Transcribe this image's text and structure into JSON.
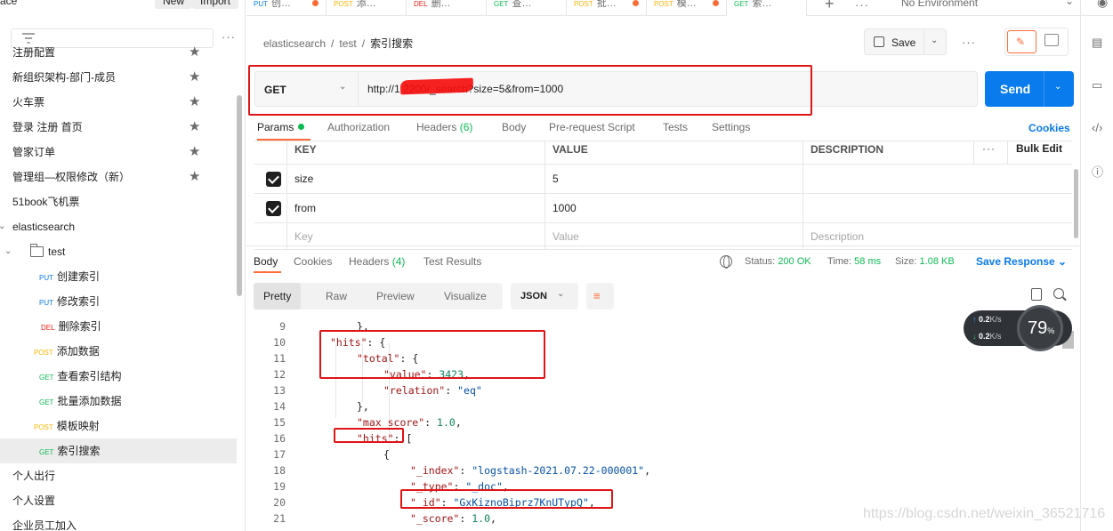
{
  "sidebar": {
    "workspace_title": "ace",
    "new_label": "New",
    "import_label": "Import",
    "more": "···",
    "items": [
      {
        "label": "注册配置",
        "indent": 14,
        "star": true
      },
      {
        "label": "新组织架构-部门-成员",
        "indent": 14,
        "star": true
      },
      {
        "label": "火车票",
        "indent": 14,
        "star": true
      },
      {
        "label": "登录 注册 首页",
        "indent": 14,
        "star": true
      },
      {
        "label": "管家订单",
        "indent": 14,
        "star": true
      },
      {
        "label": "管理组—权限修改（新）",
        "indent": 14,
        "star": true
      },
      {
        "label": "51book飞机票",
        "indent": 14,
        "star": false
      },
      {
        "label": "elasticsearch",
        "indent": 14,
        "star": false
      },
      {
        "label": "test",
        "indent": 54,
        "star": false,
        "folder": true
      },
      {
        "label": "创建索引",
        "method": "PUT",
        "indent": 44,
        "star": false
      },
      {
        "label": "修改索引",
        "method": "PUT",
        "indent": 44,
        "star": false
      },
      {
        "label": "删除索引",
        "method": "DEL",
        "indent": 46,
        "star": false
      },
      {
        "label": "添加数据",
        "method": "POST",
        "indent": 38,
        "star": false
      },
      {
        "label": "查看索引结构",
        "method": "GET",
        "indent": 44,
        "star": false
      },
      {
        "label": "批量添加数据",
        "method": "GET",
        "indent": 44,
        "star": false
      },
      {
        "label": "模板映射",
        "method": "POST",
        "indent": 38,
        "star": false
      },
      {
        "label": "索引搜索",
        "method": "GET",
        "indent": 44,
        "star": false,
        "active": true
      },
      {
        "label": "个人出行",
        "indent": 14,
        "star": false
      },
      {
        "label": "个人设置",
        "indent": 14,
        "star": false
      },
      {
        "label": "企业员工加入",
        "indent": 14,
        "star": false
      }
    ]
  },
  "tabs": [
    {
      "method": "PUT",
      "label": "创…",
      "dot": true
    },
    {
      "method": "POST",
      "label": "添…",
      "dot": false
    },
    {
      "method": "DEL",
      "label": "删…",
      "dot": false
    },
    {
      "method": "GET",
      "label": "查…",
      "dot": false
    },
    {
      "method": "POST",
      "label": "批…",
      "dot": true
    },
    {
      "method": "POST",
      "label": "模…",
      "dot": true
    },
    {
      "method": "GET",
      "label": "索…",
      "dot": false,
      "active": true
    }
  ],
  "environment": "No Environment",
  "breadcrumb": {
    "root": "elasticsearch",
    "folder": "test",
    "current": "索引搜索"
  },
  "save_label": "Save",
  "request": {
    "method": "GET",
    "url": "http://1                  2200/_search?size=5&from=1000",
    "send_label": "Send"
  },
  "request_tabs": {
    "params": "Params",
    "authorization": "Authorization",
    "headers": "Headers",
    "headers_count": "(6)",
    "body": "Body",
    "prerequest": "Pre-request Script",
    "tests": "Tests",
    "settings": "Settings",
    "cookies": "Cookies"
  },
  "params_table": {
    "key_header": "KEY",
    "value_header": "VALUE",
    "desc_header": "DESCRIPTION",
    "bulk_edit": "Bulk Edit",
    "rows": [
      {
        "key": "size",
        "value": "5"
      },
      {
        "key": "from",
        "value": "1000"
      }
    ],
    "placeholder_key": "Key",
    "placeholder_value": "Value",
    "placeholder_desc": "Description"
  },
  "response": {
    "tabs": {
      "body": "Body",
      "cookies": "Cookies",
      "headers": "Headers",
      "headers_count": "(4)",
      "test_results": "Test Results"
    },
    "status_label": "Status:",
    "status_value": "200 OK",
    "time_label": "Time:",
    "time_value": "58 ms",
    "size_label": "Size:",
    "size_value": "1.08 KB",
    "save_response": "Save Response",
    "view_modes": [
      "Pretty",
      "Raw",
      "Preview",
      "Visualize"
    ],
    "format": "JSON",
    "lines": [
      {
        "n": "9",
        "indent": 2,
        "parts": [
          [
            "p",
            "},"
          ]
        ]
      },
      {
        "n": "10",
        "indent": 1,
        "parts": [
          [
            "k",
            "\"hits\""
          ],
          [
            "p",
            ": {"
          ]
        ]
      },
      {
        "n": "11",
        "indent": 2,
        "parts": [
          [
            "k",
            "\"total\""
          ],
          [
            "p",
            ": {"
          ]
        ]
      },
      {
        "n": "12",
        "indent": 3,
        "parts": [
          [
            "k",
            "\"value\""
          ],
          [
            "p",
            ": "
          ],
          [
            "n",
            "3423"
          ],
          [
            "p",
            ","
          ]
        ]
      },
      {
        "n": "13",
        "indent": 3,
        "parts": [
          [
            "k",
            "\"relation\""
          ],
          [
            "p",
            ": "
          ],
          [
            "s",
            "\"eq\""
          ]
        ]
      },
      {
        "n": "14",
        "indent": 2,
        "parts": [
          [
            "p",
            "},"
          ]
        ]
      },
      {
        "n": "15",
        "indent": 2,
        "parts": [
          [
            "k",
            "\"max_score\""
          ],
          [
            "p",
            ": "
          ],
          [
            "n",
            "1.0"
          ],
          [
            "p",
            ","
          ]
        ]
      },
      {
        "n": "16",
        "indent": 2,
        "parts": [
          [
            "k",
            "\"hits\""
          ],
          [
            "p",
            ": ["
          ]
        ]
      },
      {
        "n": "17",
        "indent": 3,
        "parts": [
          [
            "p",
            "{"
          ]
        ]
      },
      {
        "n": "18",
        "indent": 4,
        "parts": [
          [
            "k",
            "\"_index\""
          ],
          [
            "p",
            ": "
          ],
          [
            "s",
            "\"logstash-2021.07.22-000001\""
          ],
          [
            "p",
            ","
          ]
        ]
      },
      {
        "n": "19",
        "indent": 4,
        "parts": [
          [
            "k",
            "\"_type\""
          ],
          [
            "p",
            ": "
          ],
          [
            "s",
            "\"_doc\""
          ],
          [
            "p",
            ","
          ]
        ]
      },
      {
        "n": "20",
        "indent": 4,
        "parts": [
          [
            "k",
            "\"_id\""
          ],
          [
            "p",
            ": "
          ],
          [
            "s",
            "\"GxKiznoBiprz7KnUTypQ\""
          ],
          [
            "p",
            ","
          ]
        ]
      },
      {
        "n": "21",
        "indent": 4,
        "parts": [
          [
            "k",
            "\"_score\""
          ],
          [
            "p",
            ": "
          ],
          [
            "n",
            "1.0"
          ],
          [
            "p",
            ","
          ]
        ]
      }
    ]
  },
  "network_widget": {
    "up": "0.2",
    "down": "0.2",
    "unit": "K/s",
    "percent": "79",
    "percent_sign": "%"
  },
  "watermark": "https://blog.csdn.net/weixin_36521716",
  "colors": {
    "accent": "#ff6c37",
    "send": "#097bed",
    "annotation": "#e01414",
    "success": "#0cbb52"
  }
}
